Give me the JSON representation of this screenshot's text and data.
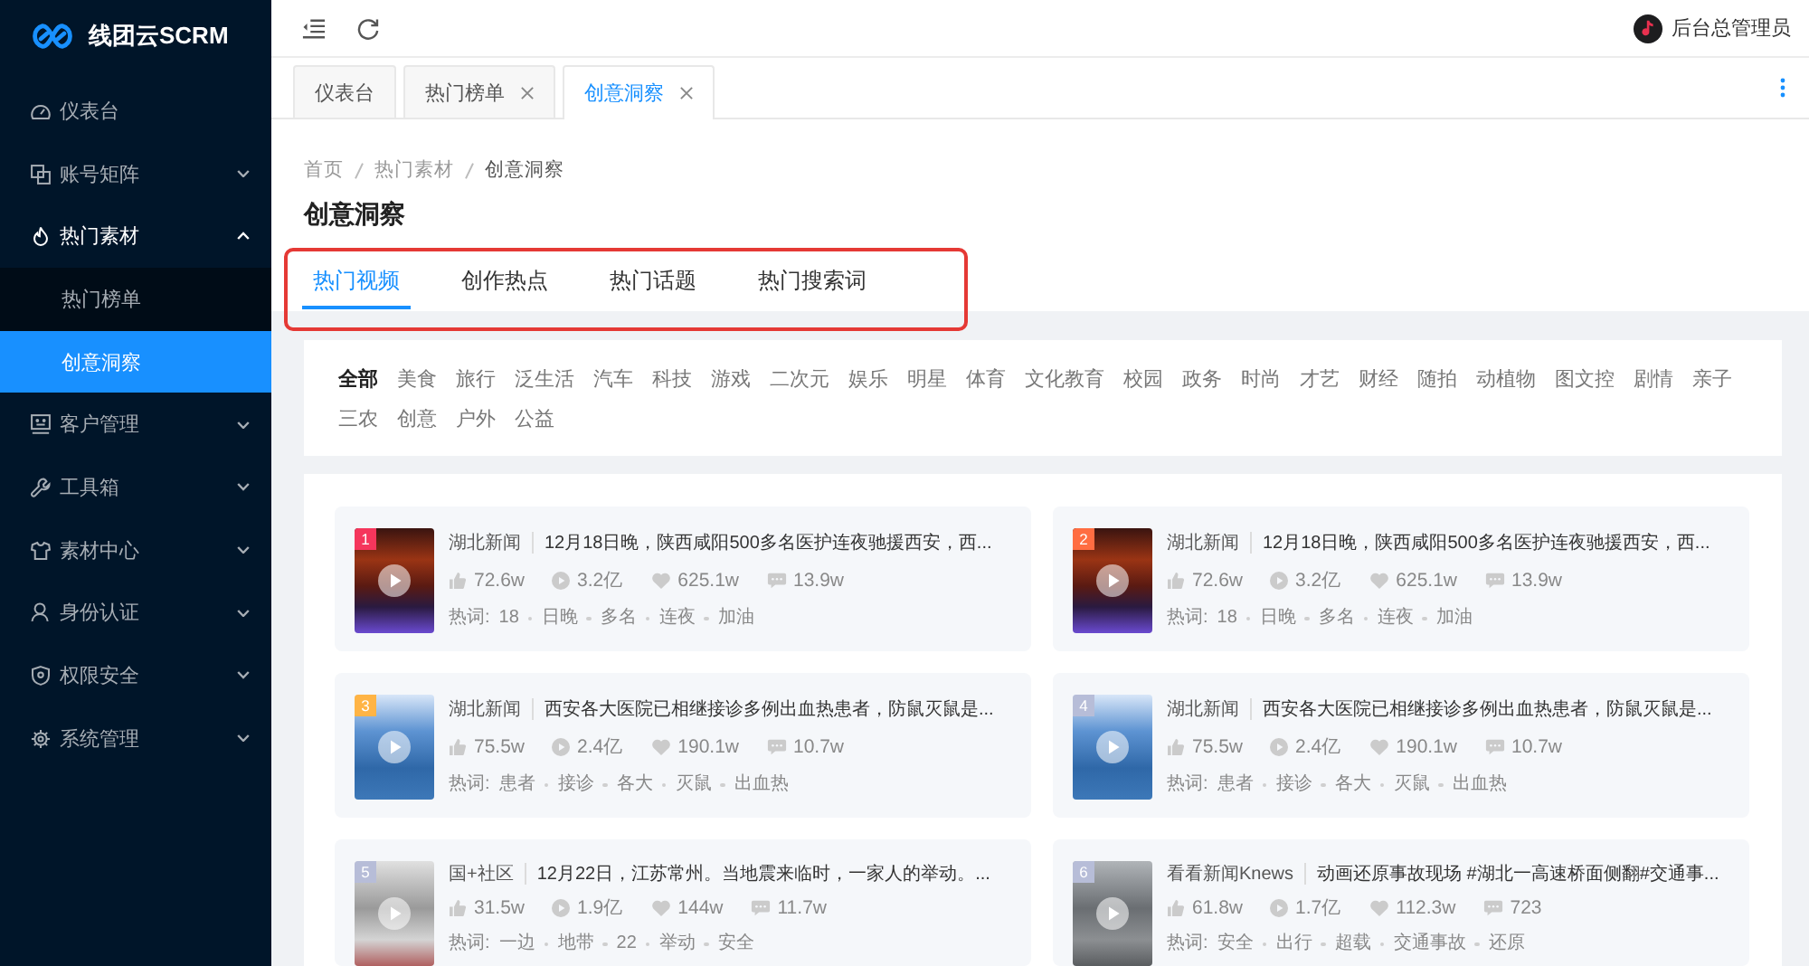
{
  "sidebar": {
    "logo": "线团云SCRM",
    "items": [
      {
        "label": "仪表台",
        "selected": false
      },
      {
        "label": "账号矩阵",
        "selected": false,
        "expanded": false
      },
      {
        "label": "热门素材",
        "selected": false,
        "expanded": true,
        "children": [
          {
            "label": "热门榜单",
            "selected": false
          },
          {
            "label": "创意洞察",
            "selected": true
          }
        ]
      },
      {
        "label": "客户管理",
        "selected": false,
        "expanded": false
      },
      {
        "label": "工具箱",
        "selected": false,
        "expanded": false
      },
      {
        "label": "素材中心",
        "selected": false,
        "expanded": false
      },
      {
        "label": "身份认证",
        "selected": false,
        "expanded": false
      },
      {
        "label": "权限安全",
        "selected": false,
        "expanded": false
      },
      {
        "label": "系统管理",
        "selected": false,
        "expanded": false
      }
    ]
  },
  "header": {
    "user_name": "后台总管理员"
  },
  "page_tabs": [
    {
      "label": "仪表台",
      "selected": false,
      "closable": false
    },
    {
      "label": "热门榜单",
      "selected": false,
      "closable": true
    },
    {
      "label": "创意洞察",
      "selected": true,
      "closable": true
    }
  ],
  "breadcrumb": [
    "首页",
    "热门素材",
    "创意洞察"
  ],
  "page_title": "创意洞察",
  "content_tabs": {
    "highlighted": true,
    "items": [
      {
        "label": "热门视频",
        "selected": true
      },
      {
        "label": "创作热点",
        "selected": false
      },
      {
        "label": "热门话题",
        "selected": false
      },
      {
        "label": "热门搜索词",
        "selected": false
      }
    ]
  },
  "categories": [
    {
      "label": "全部",
      "selected": true
    },
    {
      "label": "美食",
      "selected": false
    },
    {
      "label": "旅行",
      "selected": false
    },
    {
      "label": "泛生活",
      "selected": false
    },
    {
      "label": "汽车",
      "selected": false
    },
    {
      "label": "科技",
      "selected": false
    },
    {
      "label": "游戏",
      "selected": false
    },
    {
      "label": "二次元",
      "selected": false
    },
    {
      "label": "娱乐",
      "selected": false
    },
    {
      "label": "明星",
      "selected": false
    },
    {
      "label": "体育",
      "selected": false
    },
    {
      "label": "文化教育",
      "selected": false
    },
    {
      "label": "校园",
      "selected": false
    },
    {
      "label": "政务",
      "selected": false
    },
    {
      "label": "时尚",
      "selected": false
    },
    {
      "label": "才艺",
      "selected": false
    },
    {
      "label": "财经",
      "selected": false
    },
    {
      "label": "随拍",
      "selected": false
    },
    {
      "label": "动植物",
      "selected": false
    },
    {
      "label": "图文控",
      "selected": false
    },
    {
      "label": "剧情",
      "selected": false
    },
    {
      "label": "亲子",
      "selected": false
    },
    {
      "label": "三农",
      "selected": false
    },
    {
      "label": "创意",
      "selected": false
    },
    {
      "label": "户外",
      "selected": false
    },
    {
      "label": "公益",
      "selected": false
    }
  ],
  "cards": [
    {
      "rank": "1",
      "color": "#f5365c",
      "thumbnail": {
        "kind": "night"
      },
      "author": "湖北新闻",
      "title": "12月18日晚，陕西咸阳500多名医护连夜驰援西安，西...",
      "stats": {
        "likes": "72.6w",
        "plays": "3.2亿",
        "favorites": "625.1w",
        "comments": "13.9w"
      },
      "hot_words_label": "热词:",
      "hot_words": [
        "18",
        "日晚",
        "多名",
        "连夜",
        "加油"
      ]
    },
    {
      "rank": "2",
      "color": "#ff6d42",
      "thumbnail": {
        "kind": "night"
      },
      "author": "湖北新闻",
      "title": "12月18日晚，陕西咸阳500多名医护连夜驰援西安，西...",
      "stats": {
        "likes": "72.6w",
        "plays": "3.2亿",
        "favorites": "625.1w",
        "comments": "13.9w"
      },
      "hot_words_label": "热词:",
      "hot_words": [
        "18",
        "日晚",
        "多名",
        "连夜",
        "加油"
      ]
    },
    {
      "rank": "3",
      "color": "#ffb445",
      "thumbnail": {
        "kind": "hospital"
      },
      "author": "湖北新闻",
      "title": "西安各大医院已相继接诊多例出血热患者，防鼠灭鼠是...",
      "stats": {
        "likes": "75.5w",
        "plays": "2.4亿",
        "favorites": "190.1w",
        "comments": "10.7w"
      },
      "hot_words_label": "热词:",
      "hot_words": [
        "患者",
        "接诊",
        "各大",
        "灭鼠",
        "出血热"
      ]
    },
    {
      "rank": "4",
      "color": "#b7bdd8",
      "thumbnail": {
        "kind": "hospital"
      },
      "author": "湖北新闻",
      "title": "西安各大医院已相继接诊多例出血热患者，防鼠灭鼠是...",
      "stats": {
        "likes": "75.5w",
        "plays": "2.4亿",
        "favorites": "190.1w",
        "comments": "10.7w"
      },
      "hot_words_label": "热词:",
      "hot_words": [
        "患者",
        "接诊",
        "各大",
        "灭鼠",
        "出血热"
      ]
    },
    {
      "rank": "5",
      "color": "#b7bdd8",
      "thumbnail": {
        "kind": "indoor"
      },
      "author": "国+社区",
      "title": "12月22日，江苏常州。当地震来临时，一家人的举动。...",
      "stats": {
        "likes": "31.5w",
        "plays": "1.9亿",
        "favorites": "144w",
        "comments": "11.7w"
      },
      "hot_words_label": "热词:",
      "hot_words": [
        "一边",
        "地带",
        "22",
        "举动",
        "安全"
      ]
    },
    {
      "rank": "6",
      "color": "#b7bdd8",
      "thumbnail": {
        "kind": "road"
      },
      "author": "看看新闻Knews",
      "title": "动画还原事故现场 #湖北一高速桥面侧翻#交通事...",
      "stats": {
        "likes": "61.8w",
        "plays": "1.7亿",
        "favorites": "112.3w",
        "comments": "723"
      },
      "hot_words_label": "热词:",
      "hot_words": [
        "安全",
        "出行",
        "超载",
        "交通事故",
        "还原"
      ]
    }
  ]
}
